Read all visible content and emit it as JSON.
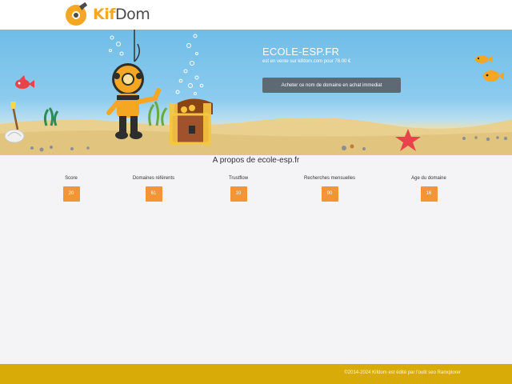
{
  "header": {
    "logo_text_kif": "Kif",
    "logo_text_dom": "Dom",
    "logo_icon": "diving-helmet-icon",
    "brand_color": "#f5a623"
  },
  "hero": {
    "domain": "ECOLE-ESP.FR",
    "subtitle": "est en vente sur kifdom.com pour 78.00 €",
    "buy_button_label": "Acheter ce nom de domaine en achat immediat"
  },
  "about": {
    "title": "A propos de ecole-esp.fr",
    "stats": [
      {
        "label": "Score",
        "value": "20"
      },
      {
        "label": "Domaines référents",
        "value": "61"
      },
      {
        "label": "Trustflow",
        "value": "10"
      },
      {
        "label": "Recherches mensuelles",
        "value": "90"
      },
      {
        "label": "Age du domaine",
        "value": "16"
      }
    ],
    "badge_color": "#f39437"
  },
  "footer": {
    "text": "©2014-2024 Kifdom est édité par l'outil seo Ranxplorer",
    "color": "#d9ab08"
  }
}
